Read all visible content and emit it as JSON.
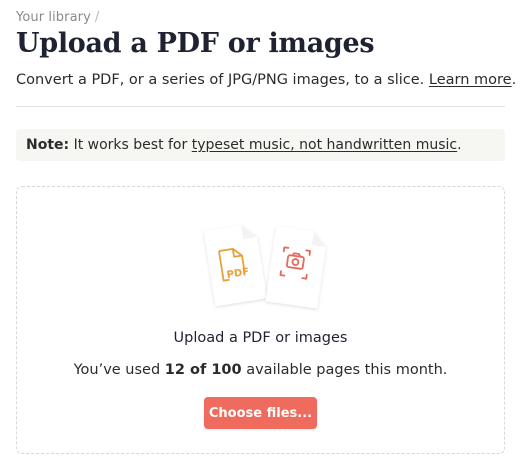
{
  "breadcrumb": {
    "link_label": "Your library",
    "separator": "/"
  },
  "page": {
    "title": "Upload a PDF or images",
    "subtitle_text": "Convert a PDF, or a series of JPG/PNG images, to a slice.",
    "subtitle_link": "Learn more",
    "subtitle_end": "."
  },
  "note": {
    "label": "Note:",
    "text": "It works best for",
    "link": "typeset music, not handwritten music",
    "end": "."
  },
  "dropzone": {
    "pdf_icon_text": "PDF",
    "title": "Upload a PDF or images",
    "usage_prefix": "You’ve used",
    "usage_count": "12 of 100",
    "usage_suffix": "available pages this month.",
    "button_label": "Choose files..."
  },
  "colors": {
    "accent": "#ee6b5d",
    "pdf_icon": "#e8a13a",
    "camera_icon": "#e66a5c",
    "note_bg": "#f6f6f3"
  }
}
